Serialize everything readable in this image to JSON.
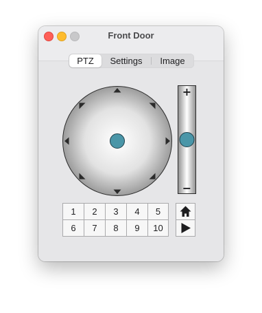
{
  "window": {
    "title": "Front Door"
  },
  "tabs": [
    {
      "label": "PTZ",
      "selected": true
    },
    {
      "label": "Settings",
      "selected": false
    },
    {
      "label": "Image",
      "selected": false
    }
  ],
  "zoom": {
    "plus_label": "+",
    "minus_label": "−",
    "level": 0.5
  },
  "presets": [
    "1",
    "2",
    "3",
    "4",
    "5",
    "6",
    "7",
    "8",
    "9",
    "10"
  ],
  "controls": {
    "home_icon": "home-icon",
    "play_icon": "play-icon"
  },
  "colors": {
    "knob": "#4a96a8",
    "accent": "#4a96a8"
  }
}
